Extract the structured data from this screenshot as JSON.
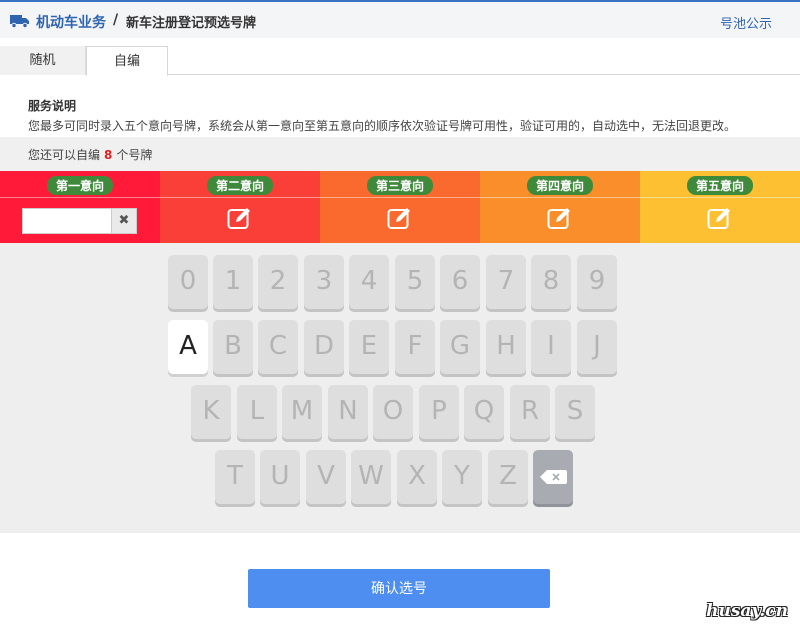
{
  "header": {
    "title": "机动车业务",
    "separator": "/",
    "subtitle": "新车注册登记预选号牌",
    "pool_link": "号池公示",
    "icon": "truck-icon",
    "accent_color": "#2f64b1"
  },
  "tabs": [
    {
      "label": "随机",
      "selected": false
    },
    {
      "label": "自编",
      "selected": true
    }
  ],
  "service": {
    "title": "服务说明",
    "text": "您最多可同时录入五个意向号牌，系统会从第一意向至第五意向的顺序依次验证号牌可用性，验证可用的，自动选中，无法回退更改。"
  },
  "remaining": {
    "prefix": "您还可以自编",
    "count": "8",
    "suffix": "个号牌"
  },
  "preferences": [
    {
      "label": "第一意向",
      "color": "#ff1a3a",
      "value": ""
    },
    {
      "label": "第二意向",
      "color": "#f93f38",
      "value": ""
    },
    {
      "label": "第三意向",
      "color": "#fa6a2e",
      "value": ""
    },
    {
      "label": "第四意向",
      "color": "#fa8e2b",
      "value": ""
    },
    {
      "label": "第五意向",
      "color": "#fdc033",
      "value": ""
    }
  ],
  "keyboard": {
    "row1": [
      "0",
      "1",
      "2",
      "3",
      "4",
      "5",
      "6",
      "7",
      "8",
      "9"
    ],
    "row2": [
      "A",
      "B",
      "C",
      "D",
      "E",
      "F",
      "G",
      "H",
      "I",
      "J"
    ],
    "row3": [
      "K",
      "L",
      "M",
      "N",
      "O",
      "P",
      "Q",
      "R",
      "S"
    ],
    "row4": [
      "T",
      "U",
      "V",
      "W",
      "X",
      "Y",
      "Z"
    ],
    "active_key": "A",
    "backspace_icon": "backspace-icon",
    "clear_icon": "close-icon",
    "edit_icon": "edit-icon"
  },
  "confirm_label": "确认选号",
  "watermark": "husay.cn"
}
